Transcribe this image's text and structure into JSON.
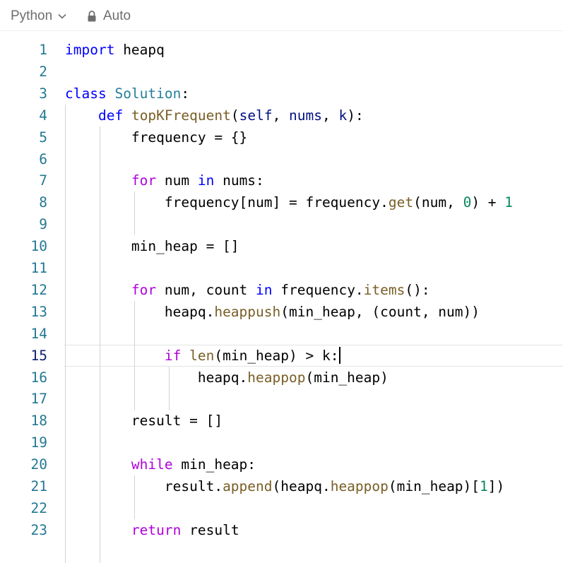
{
  "toolbar": {
    "language": "Python",
    "language_icon": "chevron-down-icon",
    "mode": "Auto",
    "mode_icon": "lock-icon"
  },
  "editor": {
    "current_line": 15,
    "colors": {
      "keyword": "#0000ff",
      "control": "#af00db",
      "class": "#267f99",
      "function": "#795e26",
      "variable": "#001080",
      "number": "#098658",
      "line_number": "#237893",
      "current_line_number": "#0b216f"
    },
    "lines": [
      {
        "n": "1",
        "tokens": [
          [
            "kw",
            "import"
          ],
          [
            "",
            "heapq"
          ]
        ]
      },
      {
        "n": "2",
        "tokens": []
      },
      {
        "n": "3",
        "tokens": [
          [
            "kw",
            "class"
          ],
          [
            "",
            " "
          ],
          [
            "cls",
            "Solution"
          ],
          [
            "",
            ":"
          ]
        ]
      },
      {
        "n": "4",
        "tokens": [
          [
            "",
            " "
          ],
          [
            "kw",
            "def"
          ],
          [
            "",
            " "
          ],
          [
            "fn",
            "topKFrequent"
          ],
          [
            "",
            "("
          ],
          [
            "var",
            "self"
          ],
          [
            "",
            ", "
          ],
          [
            "var",
            "nums"
          ],
          [
            "",
            ", "
          ],
          [
            "var",
            "k"
          ],
          [
            "",
            "):"
          ]
        ]
      },
      {
        "n": "5",
        "tokens": [
          [
            "",
            "        frequency = {}"
          ]
        ]
      },
      {
        "n": "6",
        "tokens": []
      },
      {
        "n": "7",
        "tokens": [
          [
            "",
            "        "
          ],
          [
            "ctrl",
            "for"
          ],
          [
            "",
            ""
          ],
          [
            "",
            "num "
          ],
          [
            "kw",
            "in"
          ],
          [
            "",
            " nums:"
          ]
        ]
      },
      {
        "n": "8",
        "tokens": [
          [
            "",
            "            frequency[num] = frequency."
          ],
          [
            "fn",
            "get"
          ],
          [
            "",
            "(num, "
          ],
          [
            "num",
            "0"
          ],
          [
            "",
            ") + "
          ],
          [
            "num",
            "1"
          ]
        ]
      },
      {
        "n": "9",
        "tokens": []
      },
      {
        "n": "10",
        "tokens": [
          [
            "",
            "        min_heap = []"
          ]
        ]
      },
      {
        "n": "11",
        "tokens": []
      },
      {
        "n": "12",
        "tokens": [
          [
            "",
            "        "
          ],
          [
            "ctrl",
            "for"
          ],
          [
            "",
            " num, count "
          ],
          [
            "kw",
            "in"
          ],
          [
            "",
            " frequency."
          ],
          [
            "fn",
            "items"
          ],
          [
            "",
            "():"
          ]
        ]
      },
      {
        "n": "13",
        "tokens": [
          [
            "",
            "            heapq."
          ],
          [
            "fn",
            "heappush"
          ],
          [
            "",
            "(min_heap, (count, num))"
          ]
        ]
      },
      {
        "n": "14",
        "tokens": []
      },
      {
        "n": "15",
        "tokens": [
          [
            "",
            "            "
          ],
          [
            "ctrl",
            "if"
          ],
          [
            "",
            " "
          ],
          [
            "fn",
            "len"
          ],
          [
            "",
            "(min_heap) > k:"
          ]
        ]
      },
      {
        "n": "16",
        "tokens": [
          [
            "",
            "                heapq."
          ],
          [
            "fn",
            "heappop"
          ],
          [
            "",
            "(min_heap)"
          ]
        ]
      },
      {
        "n": "17",
        "tokens": []
      },
      {
        "n": "18",
        "tokens": [
          [
            "",
            "        result = []"
          ]
        ]
      },
      {
        "n": "19",
        "tokens": []
      },
      {
        "n": "20",
        "tokens": [
          [
            "",
            "        "
          ],
          [
            "ctrl",
            "while"
          ],
          [
            "",
            " min_heap:"
          ]
        ]
      },
      {
        "n": "21",
        "tokens": [
          [
            "",
            "            result."
          ],
          [
            "fn",
            "append"
          ],
          [
            "",
            "(heapq."
          ],
          [
            "fn",
            "heappop"
          ],
          [
            "",
            "(min_heap)["
          ],
          [
            "num",
            "1"
          ],
          [
            "",
            "])"
          ]
        ]
      },
      {
        "n": "22",
        "tokens": []
      },
      {
        "n": "23",
        "tokens": [
          [
            "",
            "        "
          ],
          [
            "ctrl",
            "return"
          ],
          [
            "",
            " result"
          ]
        ]
      }
    ]
  }
}
